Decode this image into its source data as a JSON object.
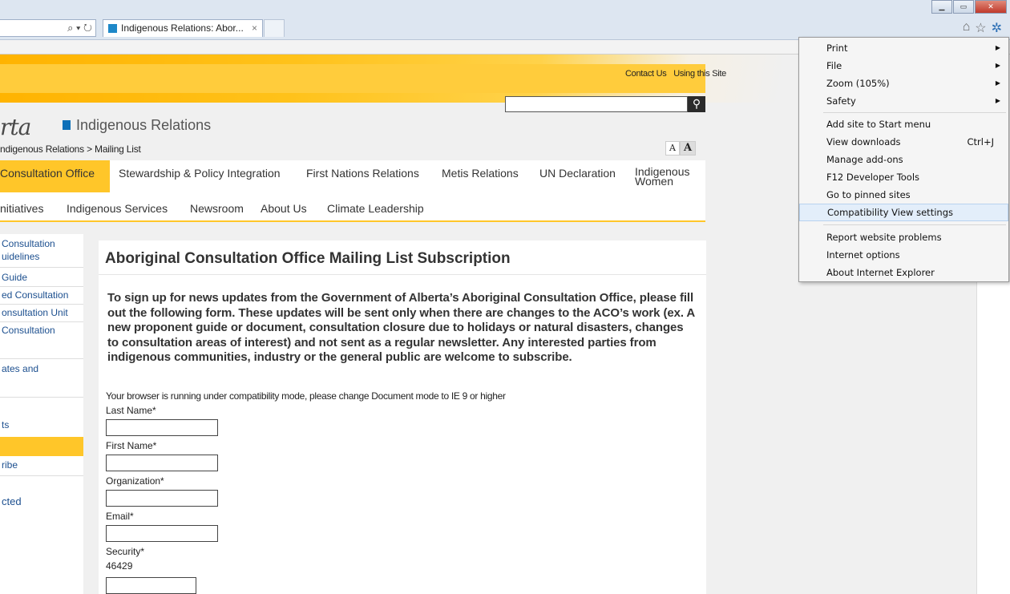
{
  "browser": {
    "tab_title": "Indigenous Relations: Abor...",
    "tab_close": "×",
    "address_icons": "⌕ ▾ ↻",
    "window_controls": [
      "▁",
      "▭",
      "✕"
    ],
    "toolbar_icons": [
      "home-icon",
      "star-icon",
      "gear-icon"
    ]
  },
  "page": {
    "top_links": [
      "Contact Us",
      "Using this Site"
    ],
    "logo_text": "rta",
    "site_name": "Indigenous Relations",
    "breadcrumb": "ndigenous Relations > Mailing List",
    "text_size": [
      "A",
      "A"
    ],
    "nav_primary": [
      "Consultation Office",
      "Stewardship & Policy Integration",
      "First Nations Relations",
      "Metis Relations",
      "UN Declaration",
      "Indigenous",
      "Women"
    ],
    "nav_secondary": [
      "nitiatives",
      "Indigenous Services",
      "Newsroom",
      "About Us",
      "Climate Leadership"
    ],
    "sidebar": [
      "Consultation",
      "uidelines",
      "Guide",
      "ed Consultation",
      "onsultation Unit",
      "Consultation",
      "ates and",
      "ts",
      "ribe",
      "cted"
    ],
    "title": "Aboriginal Consultation Office Mailing List Subscription",
    "intro": "To sign up for news updates from the Government of Alberta’s Aboriginal Consultation Office, please fill out the following form. These updates will be sent only when there are changes to the ACO’s work (ex. A new proponent guide or document, consultation closure due to holidays or natural disasters, changes to consultation areas of interest) and not sent as a regular newsletter. Any interested parties from indigenous communities, industry or the general public are welcome to subscribe.",
    "compat_note": "Your browser is running under compatibility mode, please change Document mode to IE 9 or higher",
    "form": {
      "last_name_label": "Last Name*",
      "first_name_label": "First Name*",
      "organization_label": "Organization*",
      "email_label": "Email*",
      "security_label": "Security*",
      "captcha_value": "46429"
    }
  },
  "tools_menu": {
    "items": [
      {
        "label": "Print",
        "arrow": "▶"
      },
      {
        "label": "File",
        "arrow": "▶"
      },
      {
        "label": "Zoom (105%)",
        "arrow": "▶"
      },
      {
        "label": "Safety",
        "arrow": "▶"
      },
      {
        "label": "Add site to Start menu"
      },
      {
        "label": "View downloads",
        "shortcut": "Ctrl+J"
      },
      {
        "label": "Manage add-ons"
      },
      {
        "label": "F12 Developer Tools"
      },
      {
        "label": "Go to pinned sites"
      },
      {
        "label": "Compatibility View settings"
      },
      {
        "label": "Report website problems"
      },
      {
        "label": "Internet options"
      },
      {
        "label": "About Internet Explorer"
      }
    ]
  }
}
